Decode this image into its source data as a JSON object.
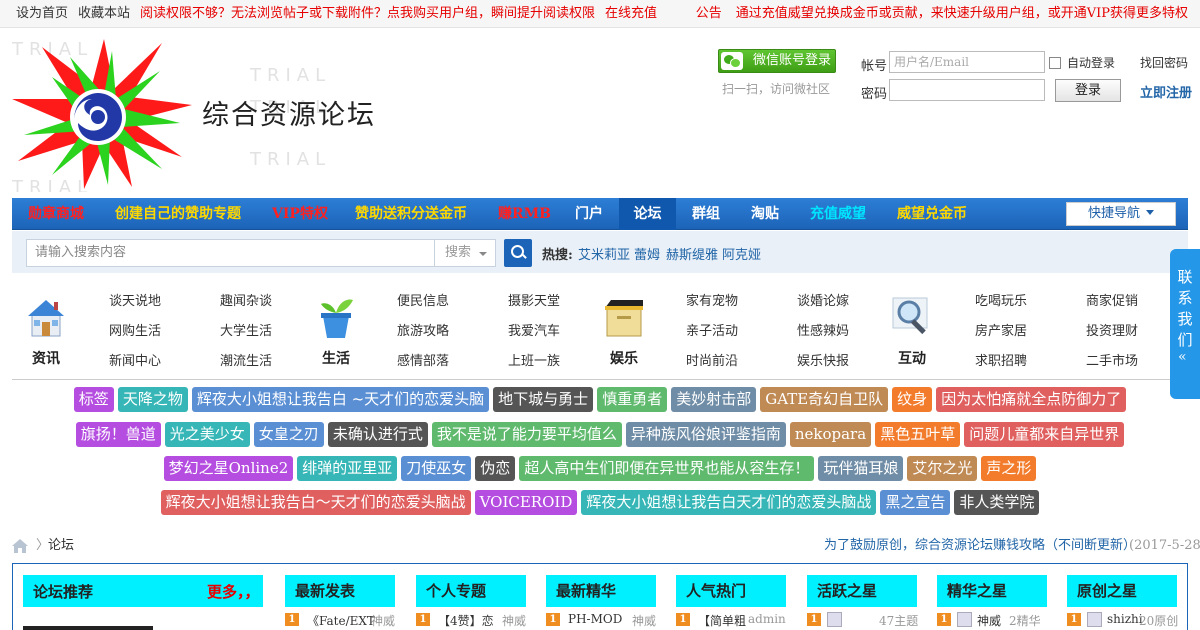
{
  "topbar": {
    "set_home": "设为首页",
    "bookmark": "收藏本站",
    "promo": "阅读权限不够？无法浏览帖子或下载附件？点我购买用户组，瞬间提升阅读权限",
    "recharge": "在线充值",
    "notice_label": "公告",
    "notice_text": "通过充值威望兑换成金币或贡献，来快速升级用户组，或开通VIP获得更多特权"
  },
  "header": {
    "site_title": "综合资源论坛",
    "watermark": "TRIAL",
    "wechat_login": "微信账号登录",
    "wechat_hint": "扫一扫，访问微社区",
    "account_label": "帐号",
    "account_placeholder": "用户名/Email",
    "auto_login": "自动登录",
    "find_password": "找回密码",
    "password_label": "密码",
    "login_button": "登录",
    "register": "立即注册"
  },
  "nav": {
    "items": [
      {
        "label": "勋章商城",
        "color": "#ff2020"
      },
      {
        "label": "创建自己的赞助专题",
        "color": "#ffd800"
      },
      {
        "label": "VIP特权",
        "color": "#ff2020"
      },
      {
        "label": "赞助送积分送金币",
        "color": "#ffd800"
      },
      {
        "label": "赚RMB",
        "color": "#ff2020"
      },
      {
        "label": "门户",
        "color": "#ffffff"
      },
      {
        "label": "论坛",
        "color": "#ffffff"
      },
      {
        "label": "群组",
        "color": "#ffffff"
      },
      {
        "label": "淘贴",
        "color": "#ffffff"
      },
      {
        "label": "充值威望",
        "color": "#00e5ff"
      },
      {
        "label": "威望兑金币",
        "color": "#ffd800"
      }
    ],
    "quick_nav": "快捷导航"
  },
  "search": {
    "placeholder": "请输入搜索内容",
    "type": "搜索",
    "hot_label": "热搜:",
    "hot_words": [
      "艾米莉亚",
      "蕾姆",
      "赫斯缇雅",
      "阿克娅"
    ]
  },
  "categories": [
    {
      "name": "资讯",
      "icon": "house-icon",
      "links": [
        "谈天说地",
        "趣闻杂谈",
        "网购生活",
        "大学生活",
        "新闻中心",
        "潮流生活"
      ]
    },
    {
      "name": "生活",
      "icon": "plant-icon",
      "links": [
        "便民信息",
        "摄影天堂",
        "旅游攻略",
        "我爱汽车",
        "感情部落",
        "上班一族"
      ]
    },
    {
      "name": "娱乐",
      "icon": "box-icon",
      "links": [
        "家有宠物",
        "谈婚论嫁",
        "亲子活动",
        "性感辣妈",
        "时尚前沿",
        "娱乐快报"
      ]
    },
    {
      "name": "互动",
      "icon": "magnifier-icon",
      "links": [
        "吃喝玩乐",
        "商家促销",
        "房产家居",
        "投资理财",
        "求职招聘",
        "二手市场"
      ]
    }
  ],
  "tags": [
    [
      {
        "text": "标签",
        "color": "#b44de0"
      },
      {
        "text": "天降之物",
        "color": "#36b6b6"
      },
      {
        "text": "辉夜大小姐想让我告白 ~天才们的恋爱头脑",
        "color": "#5b8fd4"
      },
      {
        "text": "地下城与勇士",
        "color": "#555555"
      },
      {
        "text": "慎重勇者",
        "color": "#5fba6e"
      },
      {
        "text": "美妙射击部",
        "color": "#6f8da6"
      },
      {
        "text": "GATE奇幻自卫队",
        "color": "#c08a55"
      },
      {
        "text": "纹身",
        "color": "#f37c2c"
      },
      {
        "text": "因为太怕痛就全点防御力了",
        "color": "#e06060"
      }
    ],
    [
      {
        "text": "旗扬！兽道",
        "color": "#b44de0"
      },
      {
        "text": "光之美少女",
        "color": "#36b6b6"
      },
      {
        "text": "女皇之刃",
        "color": "#5b8fd4"
      },
      {
        "text": "未确认进行式",
        "color": "#555555"
      },
      {
        "text": "我不是说了能力要平均值么",
        "color": "#5fba6e"
      },
      {
        "text": "异种族风俗娘评鉴指南",
        "color": "#6f8da6"
      },
      {
        "text": "nekopara",
        "color": "#c08a55"
      },
      {
        "text": "黑色五叶草",
        "color": "#f37c2c"
      },
      {
        "text": "问题儿童都来自异世界",
        "color": "#e06060"
      }
    ],
    [
      {
        "text": "梦幻之星Online2",
        "color": "#b44de0"
      },
      {
        "text": "绯弹的亚里亚",
        "color": "#36b6b6"
      },
      {
        "text": "刀使巫女",
        "color": "#5b8fd4"
      },
      {
        "text": "伪恋",
        "color": "#555555"
      },
      {
        "text": "超人高中生们即便在异世界也能从容生存！",
        "color": "#5fba6e"
      },
      {
        "text": "玩伴猫耳娘",
        "color": "#6f8da6"
      },
      {
        "text": "艾尔之光",
        "color": "#c08a55"
      },
      {
        "text": "声之形",
        "color": "#f37c2c"
      }
    ],
    [
      {
        "text": "辉夜大小姐想让我告白～天才们的恋爱头脑战",
        "color": "#e06060"
      },
      {
        "text": "VOICEROID",
        "color": "#b44de0"
      },
      {
        "text": "辉夜大小姐想让我告白天才们的恋爱头脑战",
        "color": "#36b6b6"
      },
      {
        "text": "黑之宣告",
        "color": "#5b8fd4"
      },
      {
        "text": "非人类学院",
        "color": "#555555"
      }
    ]
  ],
  "breadcrumb": {
    "separator": "〉",
    "current": "论坛",
    "promo": "为了鼓励原创，综合资源论坛赚钱攻略（不间断更新）",
    "date": "(2017-5-28)"
  },
  "forum": {
    "recommend_title": "论坛推荐",
    "recommend_more": "更多，，",
    "columns": [
      {
        "title": "最新发表",
        "first_num": "1",
        "first_text": "《Fate/EXT",
        "first_meta": "神威"
      },
      {
        "title": "个人专题",
        "first_num": "1",
        "first_text": "【4赞】恋",
        "first_meta": "神威"
      },
      {
        "title": "最新精华",
        "first_num": "1",
        "first_text": "PH-MOD",
        "first_meta": "神威"
      },
      {
        "title": "人气热门",
        "first_num": "1",
        "first_text": "【简单粗",
        "first_meta": "admin"
      },
      {
        "title": "活跃之星",
        "first_num": "1",
        "first_text": "",
        "first_meta": "47主题"
      },
      {
        "title": "精华之星",
        "first_num": "1",
        "first_text": "神威",
        "first_meta": "2精华"
      },
      {
        "title": "原创之星",
        "first_num": "1",
        "first_text": "shizhi",
        "first_meta": "20原创"
      }
    ]
  },
  "side_contact": {
    "text": "联系我们",
    "arrow": "«"
  }
}
